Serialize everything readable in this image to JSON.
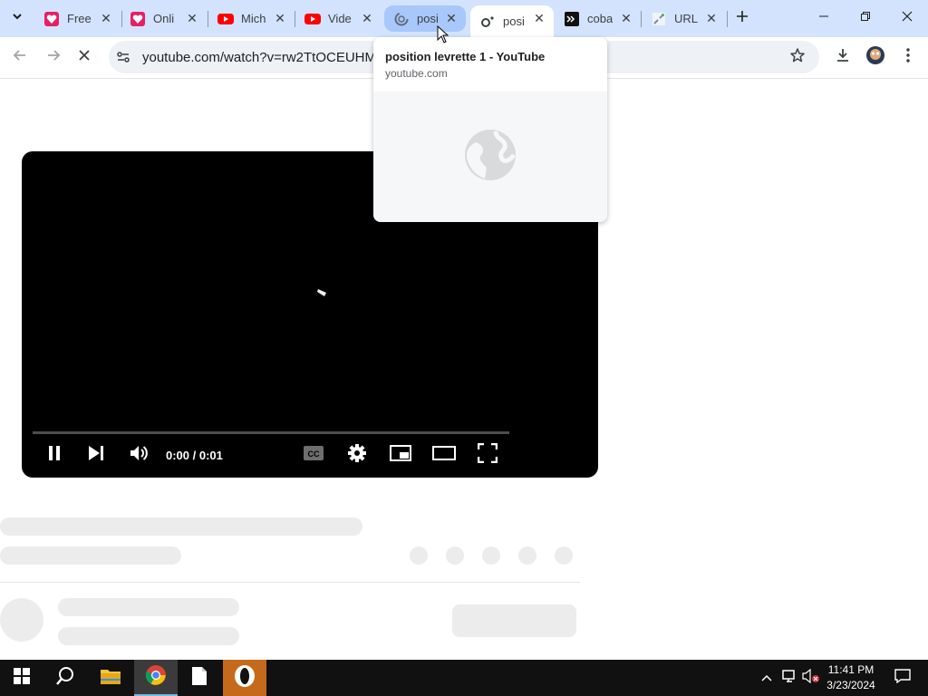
{
  "tabs": [
    {
      "title": "Free",
      "favicon": "heart-app-icon"
    },
    {
      "title": "Onli",
      "favicon": "heart-app-icon"
    },
    {
      "title": "Mich",
      "favicon": "youtube-icon"
    },
    {
      "title": "Vide",
      "favicon": "youtube-icon"
    },
    {
      "title": "posi",
      "favicon": "loading-spinner-icon"
    },
    {
      "title": "posi",
      "favicon": "loading-dots-icon"
    },
    {
      "title": "coba",
      "favicon": "terminal-prompt-icon"
    },
    {
      "title": "URL",
      "favicon": "broken-link-icon"
    }
  ],
  "address_bar": {
    "url": "youtube.com/watch?v=rw2TtOCEUHM&f"
  },
  "hover_card": {
    "title": "position levrette 1 - YouTube",
    "domain": "youtube.com"
  },
  "player": {
    "time": "0:00 / 0:01",
    "progress": 0
  },
  "taskbar": {
    "time": "11:41 PM",
    "date": "3/23/2024"
  },
  "colors": {
    "tabstrip": "#d3e3fd",
    "omnibox": "#eef1f6",
    "youtube_red": "#ff0000",
    "heart_pink": "#e91e63"
  }
}
